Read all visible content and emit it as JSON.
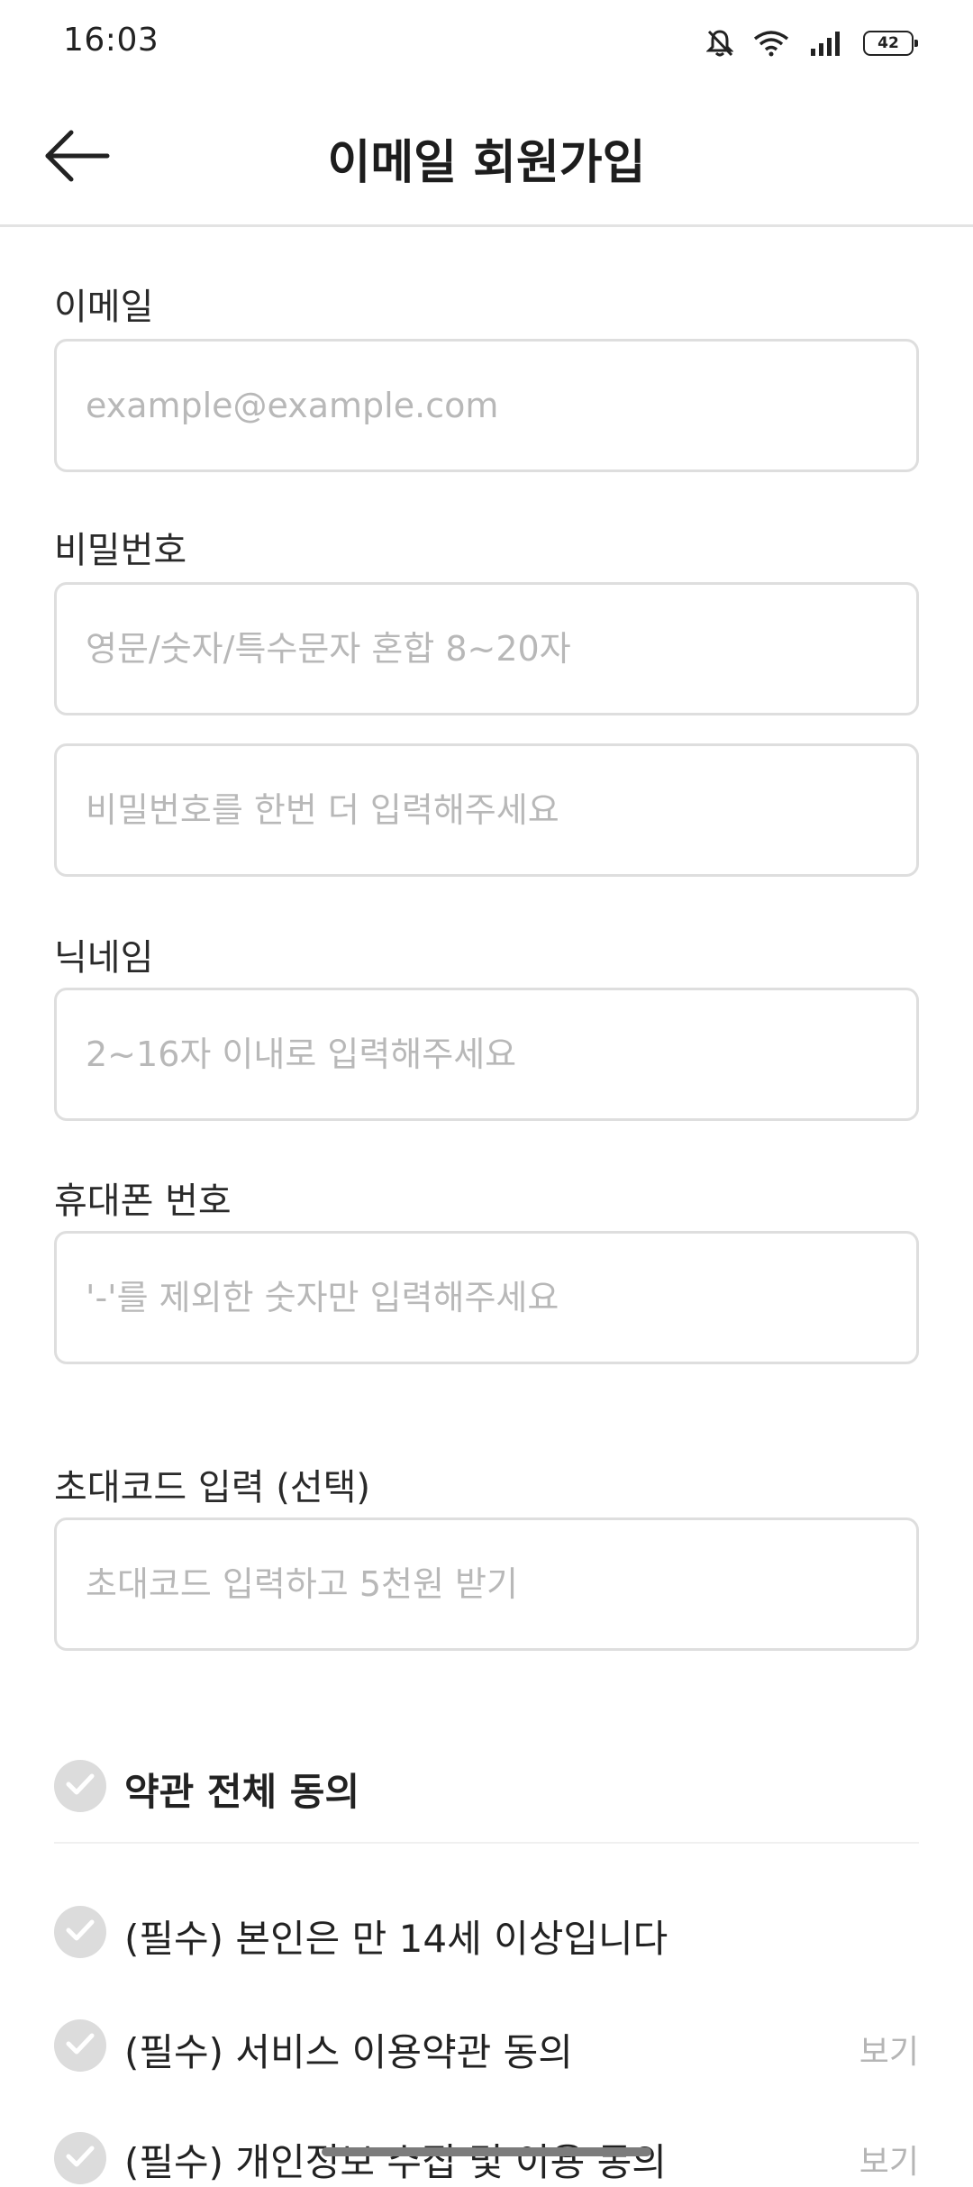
{
  "status_bar": {
    "time": "16:03",
    "battery": "42",
    "icons": [
      "bell-off-icon",
      "wifi-icon",
      "signal-icon",
      "battery-icon"
    ]
  },
  "header": {
    "title": "이메일 회원가입",
    "back_icon": "arrow-left-icon"
  },
  "form": {
    "email": {
      "label": "이메일",
      "placeholder": "example@example.com",
      "value": ""
    },
    "password": {
      "label": "비밀번호",
      "placeholder": "영문/숫자/특수문자 혼합 8~20자",
      "confirm_placeholder": "비밀번호를 한번 더 입력해주세요"
    },
    "nickname": {
      "label": "닉네임",
      "placeholder": "2~16자 이내로 입력해주세요"
    },
    "phone": {
      "label": "휴대폰 번호",
      "placeholder": "'-'를 제외한 숫자만 입력해주세요"
    },
    "invite_code": {
      "label": "초대코드 입력 (선택)",
      "placeholder": "초대코드 입력하고 5천원 받기"
    }
  },
  "terms": {
    "all_label": "약관 전체 동의",
    "items": [
      {
        "label": "(필수) 본인은 만 14세 이상입니다",
        "view": ""
      },
      {
        "label": "(필수) 서비스 이용약관 동의",
        "view": "보기"
      },
      {
        "label": "(필수) 개인정보 수집 및 이용 동의",
        "view": "보기"
      }
    ]
  },
  "colors": {
    "check_circle": "#dcdcdc",
    "border": "#dedede",
    "placeholder": "#b8b8b8",
    "view_link": "#b5b5b5"
  }
}
